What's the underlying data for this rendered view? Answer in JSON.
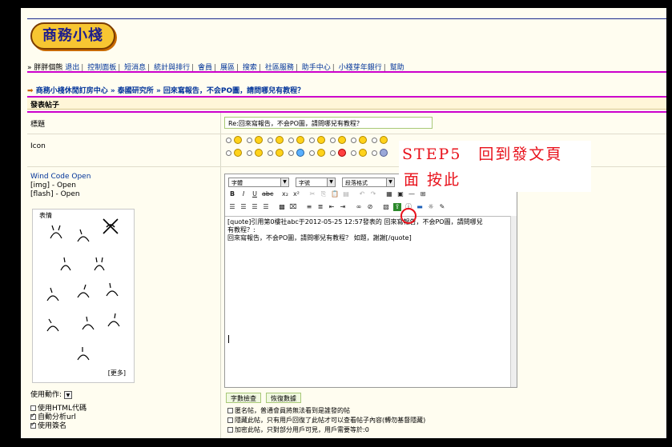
{
  "site": {
    "logo_text": "商務小棧"
  },
  "nav": {
    "prefix": "» ",
    "user": "胖胖個熊",
    "items": [
      "退出",
      "控制面板",
      "短消息",
      "統計與排行",
      "會員",
      "展區",
      "搜索",
      "社區服務",
      "助手中心",
      "小棧芽年銀行",
      "幫助"
    ]
  },
  "breadcrumb": {
    "parts": [
      "商務小棧休閒訂房中心",
      "泰國研究所",
      "回來寫報告，不会PO圖，請問哪兒有教程？"
    ]
  },
  "post_header": "發表帖子",
  "title_row": {
    "label": "標題",
    "value": "Re:回來寫報告，不会PO圖，請問哪兒有教程？"
  },
  "icon_row": {
    "label": "Icon"
  },
  "wind_code": {
    "title": "Wind Code Open",
    "img": "[img] - Open",
    "flash": "[flash] - Open"
  },
  "smilies": {
    "caption": "表情",
    "more": "[更多]"
  },
  "action": {
    "label": "使用動作:"
  },
  "options": [
    {
      "label": "使用HTML代碼",
      "checked": false
    },
    {
      "label": "自動分析url",
      "checked": true
    },
    {
      "label": "使用簽名",
      "checked": true
    }
  ],
  "editor": {
    "font_select": "字體",
    "size_select": "字號",
    "format_select": "段落格式",
    "content_line1": "[quote]引用第0樓社abc于2012-05-25 12:57發表的 回來寫報告，不会PO圖，請問哪兒",
    "content_line2": "有教程？:",
    "content_line3": "回來寫報告，不会PO圖，請問哪兒有教程？ 如題，謝謝[/quote]"
  },
  "buttons": {
    "count": "字數檢查",
    "restore": "恢復數據"
  },
  "right_checks": [
    "匿名帖，普通會員將無法看到是誰發的帖",
    "隱藏此帖，只有用戶回復了此帖才可以查看帖子內容(轉勿基督隱藏)",
    "加密此帖，只對部分用戶可見，用戶需要等於:0"
  ],
  "callout": {
    "line1": "STEP5　回到發文頁",
    "line2": "面 按此"
  },
  "colors": {
    "accent": "#cc00cc",
    "link": "#003399",
    "callout": "#e8101a"
  }
}
